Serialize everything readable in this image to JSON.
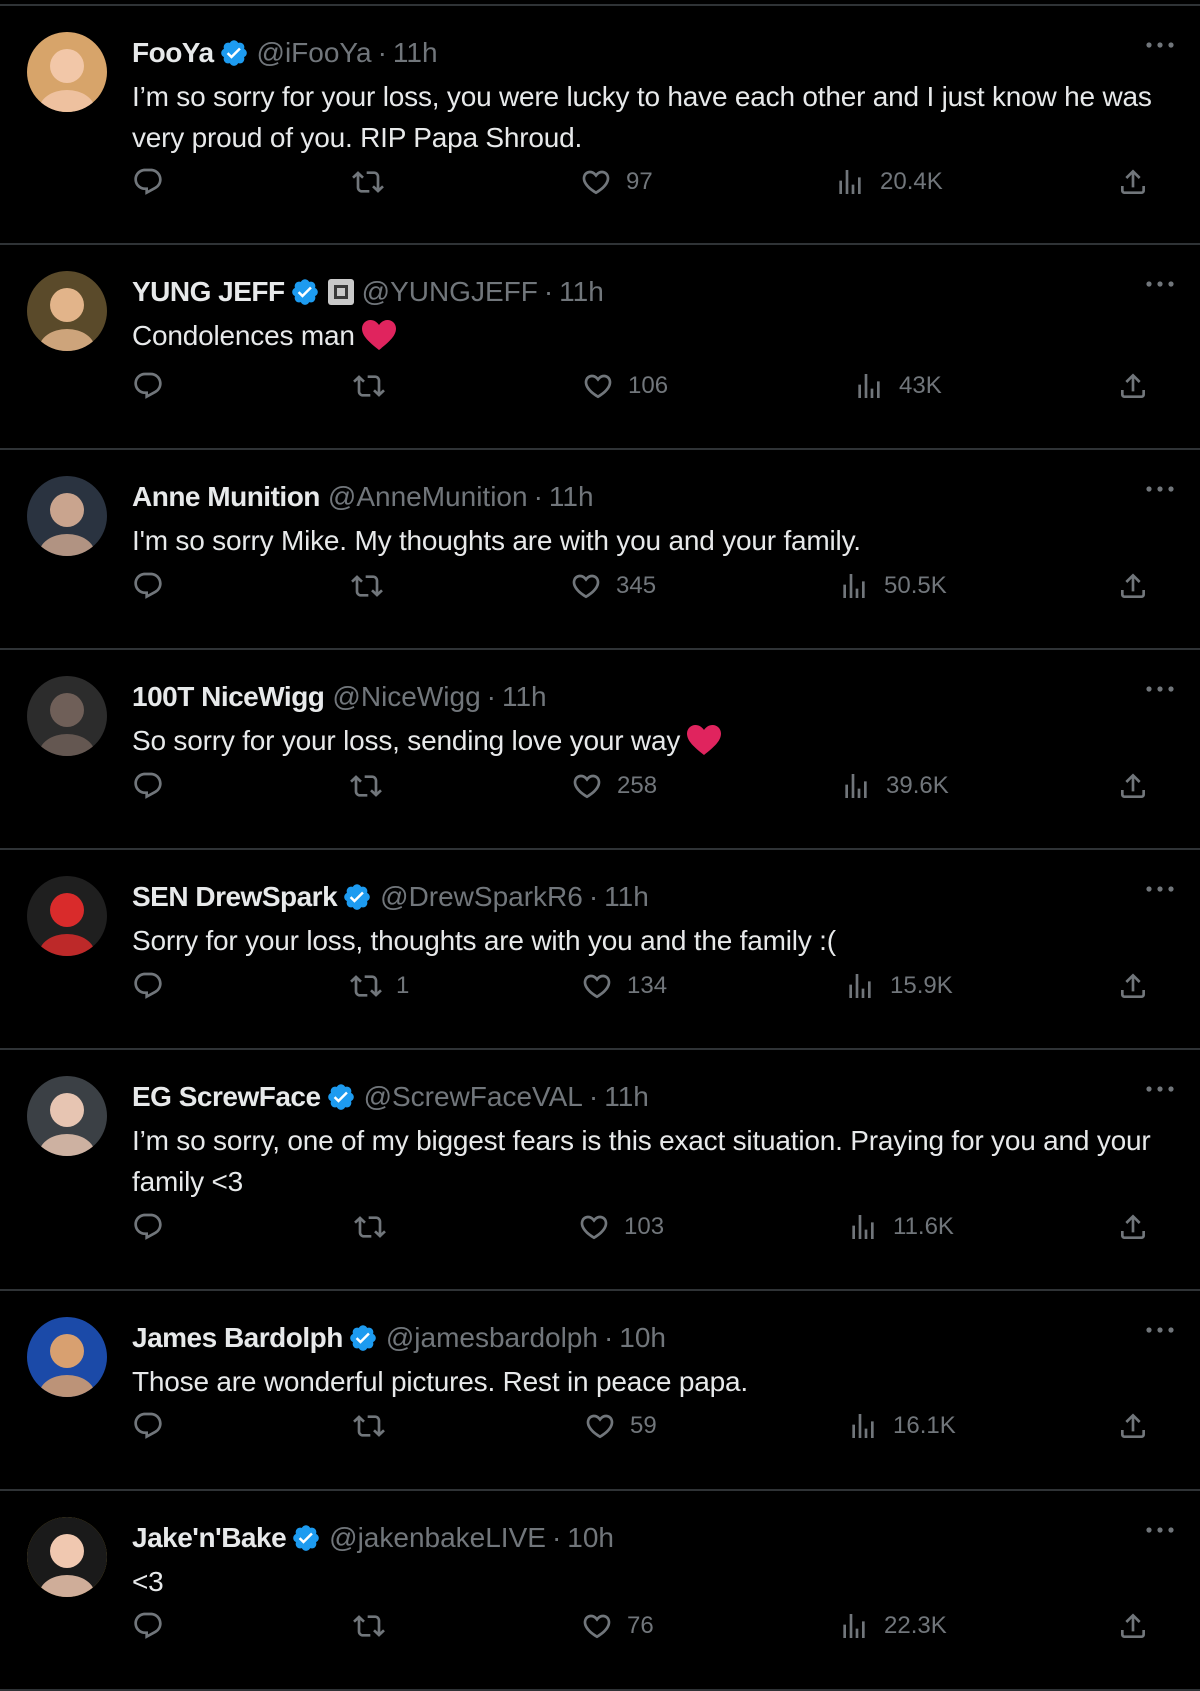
{
  "colors": {
    "background": "#000000",
    "text": "#e7e9ea",
    "muted": "#71767b",
    "divider": "#2f3336",
    "verified": "#1d9bf0",
    "heart_emoji": "#e0245e"
  },
  "icons": {
    "more": "more-icon",
    "reply": "reply-icon",
    "retweet": "retweet-icon",
    "like": "like-icon",
    "views": "views-icon",
    "share": "share-icon",
    "verified": "verified-badge-icon"
  },
  "tweets": [
    {
      "name": "FooYa",
      "verified": true,
      "affiliate": false,
      "handle": "@iFooYa",
      "sep": "·",
      "time": "11h",
      "text": "I’m so sorry for your loss, you were lucky to have each other and I just know he was very proud of you. RIP Papa Shroud.",
      "heart": false,
      "replies": "",
      "retweets": "",
      "likes": "97",
      "views": "20.4K"
    },
    {
      "name": "YUNG JEFF",
      "verified": true,
      "affiliate": true,
      "handle": "@YUNGJEFF",
      "sep": "·",
      "time": "11h",
      "text": "Condolences man",
      "heart": true,
      "replies": "",
      "retweets": "",
      "likes": "106",
      "views": "43K"
    },
    {
      "name": "Anne Munition",
      "verified": false,
      "affiliate": false,
      "handle": "@AnneMunition",
      "sep": "·",
      "time": "11h",
      "text": "I'm so sorry Mike. My thoughts are with you and your family.",
      "heart": false,
      "replies": "",
      "retweets": "",
      "likes": "345",
      "views": "50.5K"
    },
    {
      "name": "100T NiceWigg",
      "verified": false,
      "affiliate": false,
      "handle": "@NiceWigg",
      "sep": "·",
      "time": "11h",
      "text": "So sorry for your loss, sending love your way",
      "heart": true,
      "replies": "",
      "retweets": "",
      "likes": "258",
      "views": "39.6K"
    },
    {
      "name": "SEN DrewSpark",
      "verified": true,
      "affiliate": false,
      "handle": "@DrewSparkR6",
      "sep": "·",
      "time": "11h",
      "text": "Sorry for your loss, thoughts are with you and the family :(",
      "heart": false,
      "replies": "",
      "retweets": "1",
      "likes": "134",
      "views": "15.9K"
    },
    {
      "name": "EG ScrewFace",
      "verified": true,
      "affiliate": false,
      "handle": "@ScrewFaceVAL",
      "sep": "·",
      "time": "11h",
      "text": "I’m so sorry, one of my biggest fears is this exact situation. Praying for you and your family <3",
      "heart": false,
      "replies": "",
      "retweets": "",
      "likes": "103",
      "views": "11.6K"
    },
    {
      "name": "James Bardolph",
      "verified": true,
      "affiliate": false,
      "handle": "@jamesbardolph",
      "sep": "·",
      "time": "10h",
      "text": "Those are wonderful pictures. Rest in peace papa.",
      "heart": false,
      "replies": "",
      "retweets": "",
      "likes": "59",
      "views": "16.1K"
    },
    {
      "name": "Jake'n'Bake",
      "verified": true,
      "affiliate": false,
      "handle": "@jakenbakeLIVE",
      "sep": "·",
      "time": "10h",
      "text": "<3",
      "heart": false,
      "replies": "",
      "retweets": "",
      "likes": "76",
      "views": "22.3K"
    }
  ]
}
